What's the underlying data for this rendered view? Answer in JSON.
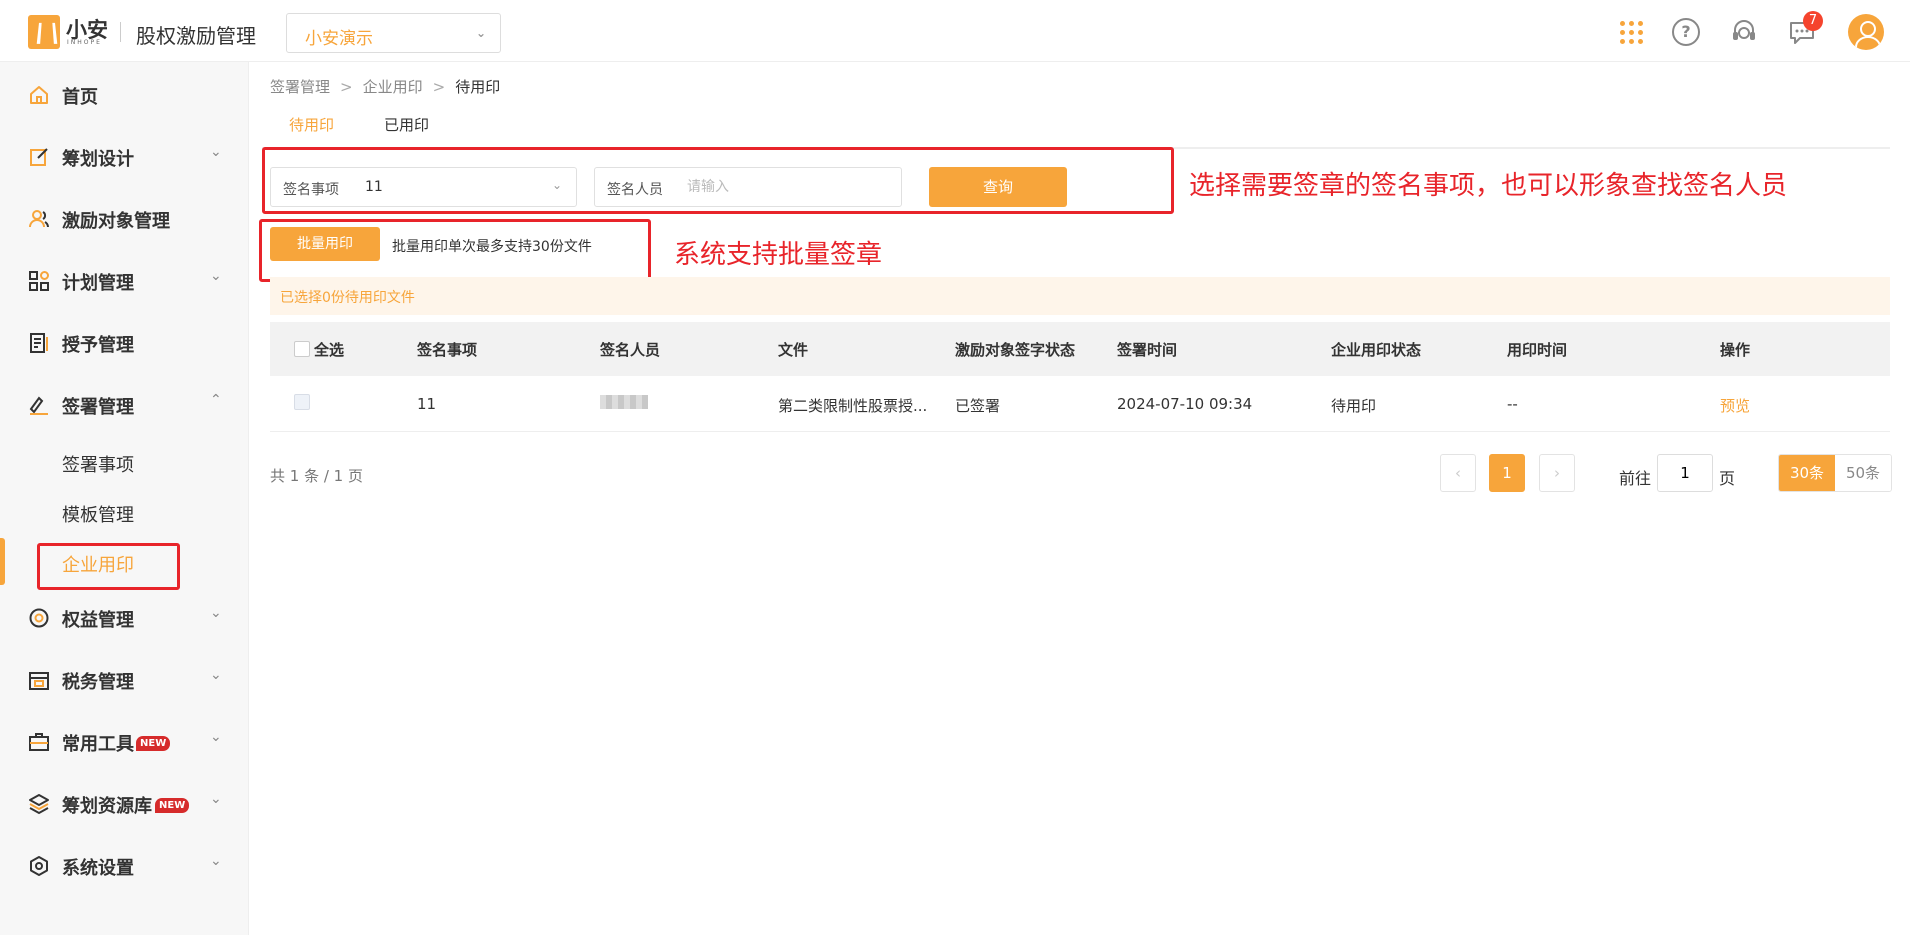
{
  "header": {
    "logo_text": "小安",
    "logo_sub": "INHOPE",
    "app_title": "股权激励管理",
    "company": "小安演示",
    "message_count": "7"
  },
  "sidebar": {
    "items": [
      {
        "label": "首页"
      },
      {
        "label": "筹划设计"
      },
      {
        "label": "激励对象管理"
      },
      {
        "label": "计划管理"
      },
      {
        "label": "授予管理"
      },
      {
        "label": "签署管理"
      },
      {
        "label": "权益管理"
      },
      {
        "label": "税务管理"
      },
      {
        "label": "常用工具",
        "badge": "NEW"
      },
      {
        "label": "筹划资源库",
        "badge": "NEW"
      },
      {
        "label": "系统设置"
      }
    ],
    "sub_items": [
      {
        "label": "签署事项"
      },
      {
        "label": "模板管理"
      },
      {
        "label": "企业用印"
      }
    ]
  },
  "breadcrumb": [
    "签署管理",
    "企业用印",
    "待用印"
  ],
  "tabs": [
    "待用印",
    "已用印"
  ],
  "filters": {
    "sign_item_label": "签名事项",
    "sign_item_value": "11",
    "signer_label": "签名人员",
    "signer_placeholder": "请输入",
    "query_label": "查询"
  },
  "batch": {
    "button_label": "批量用印",
    "hint": "批量用印单次最多支持30份文件"
  },
  "selected_info": "已选择0份待用印文件",
  "annotations": {
    "search": "选择需要签章的签名事项，也可以形象查找签名人员",
    "batch": "系统支持批量签章"
  },
  "table": {
    "select_all": "全选",
    "columns": [
      "签名事项",
      "签名人员",
      "文件",
      "激励对象签字状态",
      "签署时间",
      "企业用印状态",
      "用印时间",
      "操作"
    ],
    "rows": [
      {
        "sign_item": "11",
        "file": "第二类限制性股票授...",
        "sign_status": "已签署",
        "sign_time": "2024-07-10 09:34",
        "seal_status": "待用印",
        "seal_time": "--",
        "action": "预览"
      }
    ]
  },
  "pagination": {
    "total": "共 1 条 / 1 页",
    "current_page": "1",
    "goto_label": "前往",
    "goto_value": "1",
    "page_unit": "页",
    "sizes": [
      "30条",
      "50条"
    ]
  }
}
